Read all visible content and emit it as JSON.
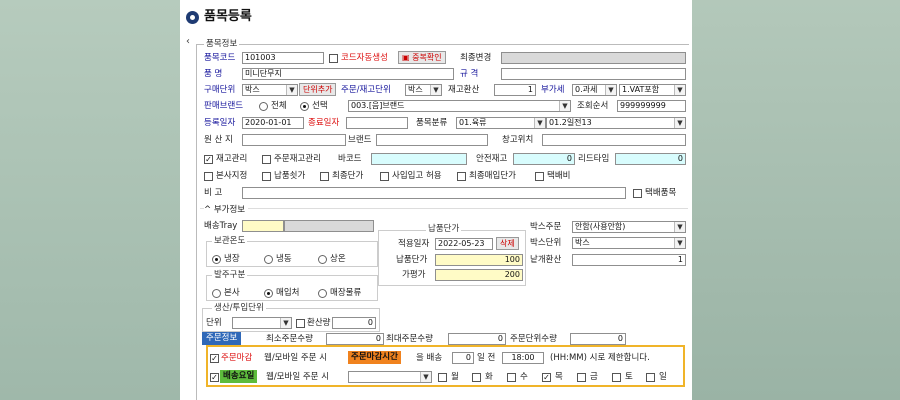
{
  "title": "품목등록",
  "section_info": "품목정보",
  "item_code": {
    "label": "품목코드",
    "value": "101003"
  },
  "auto_code": {
    "label": "코드자동생성",
    "checked": false
  },
  "dup_check": "중복확인",
  "last_change_label": "최종변경",
  "item_name": {
    "label": "품    명",
    "value": "미니단무지"
  },
  "spec": {
    "label": "규    격",
    "value": ""
  },
  "buy_unit": {
    "label": "구매단위",
    "value": "박스"
  },
  "unit_add": "단위추가",
  "order_unit_label": "주문/재고단위",
  "order_unit": "박스",
  "stock_conv": {
    "label": "재고환산",
    "value": "1"
  },
  "vat": {
    "label": "부가세",
    "tax": "0.과세",
    "vat": "1.VAT포함"
  },
  "brand": {
    "label": "판매브랜드",
    "opt_all": "전체",
    "opt_sel": "선택",
    "selected": "선택",
    "value": "003.[음]브랜드"
  },
  "inquiry_order": {
    "label": "조회순서",
    "value": "999999999"
  },
  "reg_date": {
    "label": "등록일자",
    "value": "2020-01-01"
  },
  "end_date": {
    "label": "종료일자",
    "value": ""
  },
  "category": {
    "label": "품목분류",
    "value": "01.육류",
    "sub": "01.2일전13"
  },
  "origin": {
    "label": "원 산 지",
    "value": ""
  },
  "brand_name": {
    "label": "브랜드",
    "value": ""
  },
  "warehouse_loc": {
    "label": "창고위치",
    "value": ""
  },
  "stock_mgmt": {
    "label": "재고관리",
    "checked": true
  },
  "order_stock_mgmt": {
    "label": "주문재고관리",
    "checked": false
  },
  "barcode": {
    "label": "바코드",
    "value": ""
  },
  "safety_stock": {
    "label": "안전재고",
    "value": "0"
  },
  "lead_time": {
    "label": "리드타임",
    "value": "0"
  },
  "flags": [
    {
      "label": "본사지정",
      "checked": false
    },
    {
      "label": "납품쇳가",
      "checked": false
    },
    {
      "label": "최종단가",
      "checked": false
    },
    {
      "label": "사입입고 허용",
      "checked": false
    },
    {
      "label": "최종매입단가",
      "checked": false
    },
    {
      "label": "택배비",
      "checked": false
    }
  ],
  "remarks": {
    "label": "비    고",
    "value": ""
  },
  "parcel_item": {
    "label": "택배품목",
    "checked": false
  },
  "section_extra": "부가정보",
  "delivery_tray": {
    "label": "배송Tray",
    "value": ""
  },
  "storage": {
    "title": "보관온도",
    "options": [
      "냉장",
      "냉동",
      "상온"
    ],
    "selected": "냉장"
  },
  "order_type": {
    "title": "발주구분",
    "options": [
      "본사",
      "매입처",
      "매장물류"
    ],
    "selected": "매입처"
  },
  "production": {
    "title": "생산/투입단위",
    "unit_label": "단위",
    "conv_label": "환산량",
    "conv_value": "0"
  },
  "price": {
    "title": "납품단가",
    "apply_label": "적용일자",
    "apply_date": "2022-05-23",
    "delete": "삭제",
    "unit_price_label": "납품단가",
    "unit_price": "100",
    "list_price_label": "가평가",
    "list_price": "200"
  },
  "box_order": {
    "label": "박스주문",
    "value": "안함(사용안함)"
  },
  "box_unit": {
    "label": "박스단위",
    "value": "박스"
  },
  "piece_conv": {
    "label": "낱개환산",
    "value": "1"
  },
  "order_info_tab": "주문정보",
  "min_order": {
    "label": "최소주문수량",
    "value": "0"
  },
  "max_order": {
    "label": "최대주문수량",
    "value": "0"
  },
  "order_unit_qty": {
    "label": "주문단위수량",
    "value": "0"
  },
  "order_deadline": {
    "label": "주문마감",
    "checked": true,
    "text1": "웹/모바일 주문 시",
    "badge": "주문마감시간",
    "text2": "을 배송",
    "days": "0",
    "text3": "일 전",
    "time": "18:00",
    "text4": "(HH:MM) 시로 제한합니다."
  },
  "delivery_day": {
    "label": "배송요일",
    "checked": true,
    "text1": "웹/모바일 주문 시",
    "select": "",
    "days": [
      {
        "label": "월",
        "checked": false
      },
      {
        "label": "화",
        "checked": false
      },
      {
        "label": "수",
        "checked": false
      },
      {
        "label": "목",
        "checked": true
      },
      {
        "label": "금",
        "checked": false
      },
      {
        "label": "토",
        "checked": false
      },
      {
        "label": "일",
        "checked": false
      }
    ]
  },
  "colors": {
    "label_blue": "#17169c",
    "label_red": "#dd1111",
    "yellow_field": "#fffbc6",
    "cyan_field": "#d8fcfd",
    "tab_blue": "#2f68b8",
    "deadline_orange": "#f0821e",
    "delivery_green": "#5dbb3c",
    "frame": "#f0b429"
  }
}
